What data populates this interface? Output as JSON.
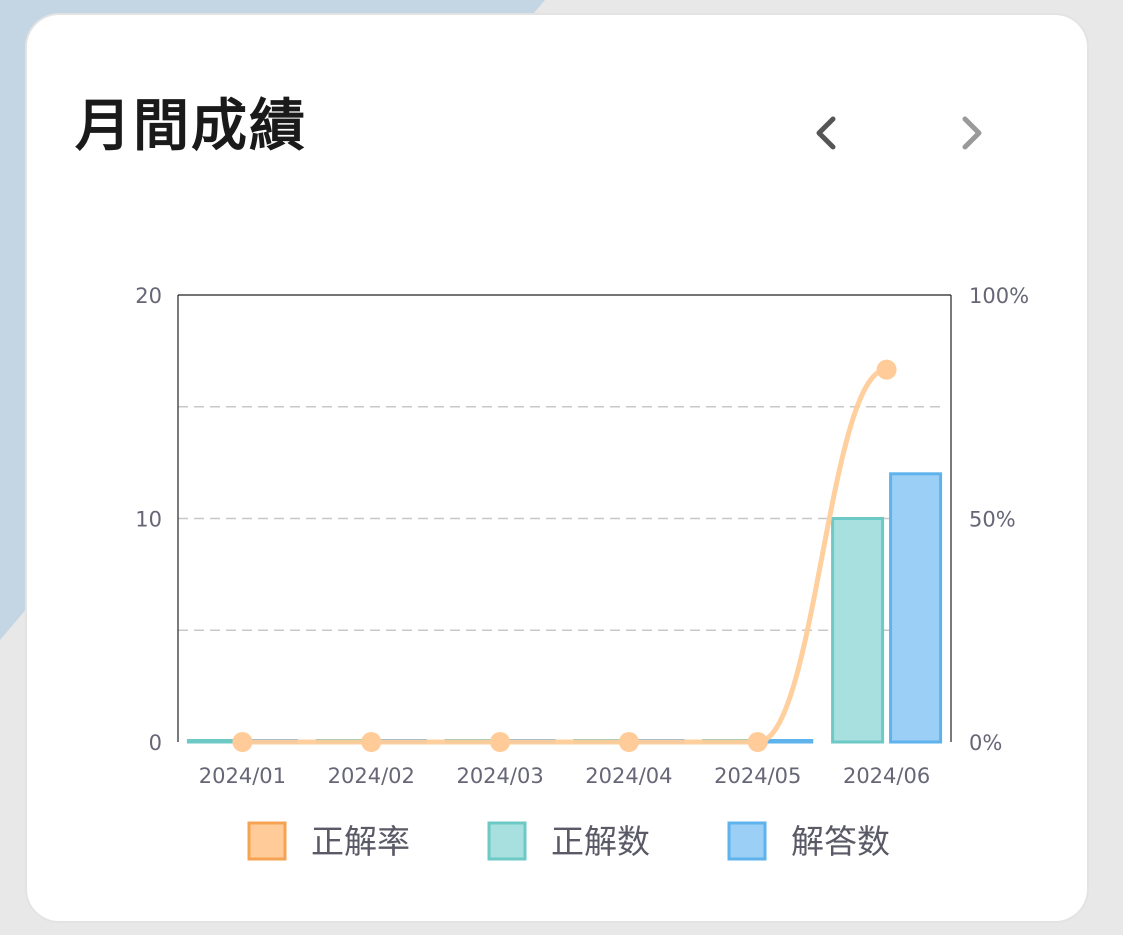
{
  "card": {
    "title": "月間成績",
    "nav": {
      "prev_icon": "chevron-left-icon",
      "next_icon": "chevron-right-icon"
    }
  },
  "colors": {
    "rate_line": "#ffcc99",
    "rate_border": "#f5a352",
    "correct_fill": "#a8e0df",
    "correct_border": "#6cc9c6",
    "answers_fill": "#9ccff5",
    "answers_border": "#5eb3ec",
    "grid": "#c8c8c8",
    "axis": "#222222",
    "tick_text": "#666677"
  },
  "chart_data": {
    "type": "bar",
    "categories": [
      "2024/01",
      "2024/02",
      "2024/03",
      "2024/04",
      "2024/05",
      "2024/06"
    ],
    "series": [
      {
        "name": "正解率",
        "type": "line",
        "axis": "right",
        "values": [
          0,
          0,
          0,
          0,
          0,
          83.3
        ]
      },
      {
        "name": "正解数",
        "type": "bar",
        "axis": "left",
        "values": [
          0,
          0,
          0,
          0,
          0,
          10
        ]
      },
      {
        "name": "解答数",
        "type": "bar",
        "axis": "left",
        "values": [
          0,
          0,
          0,
          0,
          0,
          12
        ]
      }
    ],
    "y_left": {
      "range": [
        0,
        20
      ],
      "ticks": [
        "0",
        "10",
        "20"
      ],
      "grid_values": [
        5,
        10,
        15
      ]
    },
    "y_right": {
      "range": [
        0,
        100
      ],
      "ticks": [
        "0%",
        "50%",
        "100%"
      ]
    },
    "legend": [
      "正解率",
      "正解数",
      "解答数"
    ],
    "legend_placement": "bottom",
    "grid": "dashed-horizontal"
  }
}
